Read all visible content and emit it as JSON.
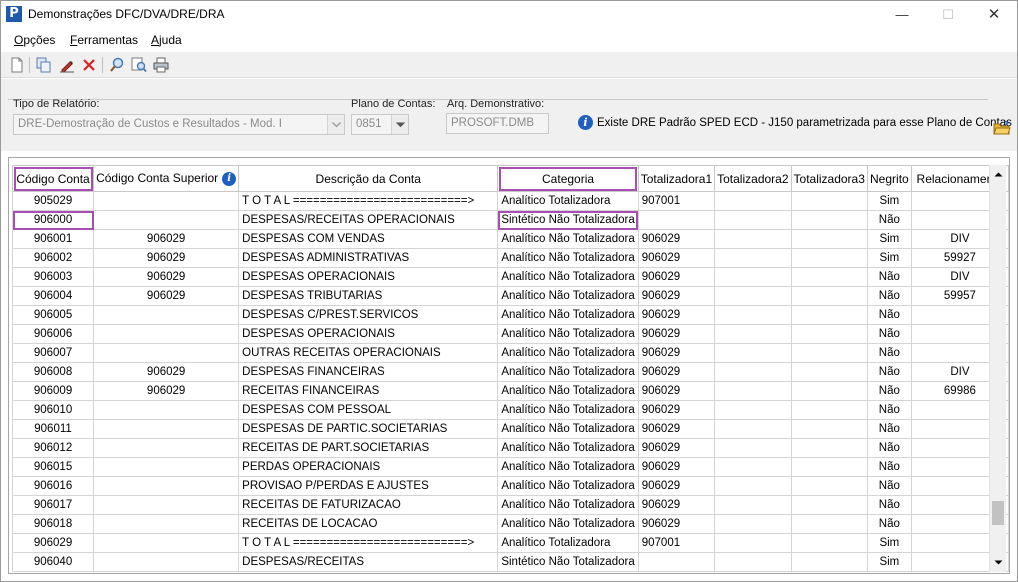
{
  "window": {
    "title": "Demonstrações DFC/DVA/DRE/DRA",
    "app_icon_letter": "P",
    "minimize": "—",
    "maximize": "☐",
    "close": "✕"
  },
  "menu": {
    "items": [
      {
        "key": "O",
        "rest": "pções"
      },
      {
        "key": "F",
        "rest": "erramentas"
      },
      {
        "key": "A",
        "rest": "juda"
      }
    ]
  },
  "toolbar": {
    "icons": [
      "new-document-icon",
      "copy-icon",
      "edit-icon",
      "delete-icon",
      "search-icon",
      "zoom-icon",
      "print-icon"
    ]
  },
  "params": {
    "tipo_relatorio_label": "Tipo de Relatório:",
    "tipo_relatorio_value": "DRE-Demostração de Custos e Resultados - Mod. I",
    "plano_contas_label": "Plano de Contas:",
    "plano_contas_value": "0851",
    "arq_demonstrativo_label": "Arq. Demonstrativo:",
    "arq_demonstrativo_value": "PROSOFT.DMB",
    "info_message": "Existe DRE Padrão SPED ECD - J150 parametrizada para esse Plano de Contas"
  },
  "grid": {
    "columns": [
      "Código Conta",
      "Código Conta Superior",
      "Descrição da Conta",
      "Categoria",
      "Totalizadora1",
      "Totalizadora2",
      "Totalizadora3",
      "Negrito",
      "Relacionamento"
    ],
    "rows": [
      [
        "905029",
        "",
        "T O T A L ==========================>",
        "Analítico Totalizadora",
        "907001",
        "",
        "",
        "Sim",
        ""
      ],
      [
        "906000",
        "",
        "DESPESAS/RECEITAS OPERACIONAIS",
        "Sintético Não Totalizadora",
        "",
        "",
        "",
        "Não",
        ""
      ],
      [
        "906001",
        "906029",
        "DESPESAS COM VENDAS",
        "Analítico Não Totalizadora",
        "906029",
        "",
        "",
        "Sim",
        "DIV"
      ],
      [
        "906002",
        "906029",
        "DESPESAS ADMINISTRATIVAS",
        "Analítico Não Totalizadora",
        "906029",
        "",
        "",
        "Sim",
        "59927"
      ],
      [
        "906003",
        "906029",
        "DESPESAS OPERACIONAIS",
        "Analítico Não Totalizadora",
        "906029",
        "",
        "",
        "Não",
        "DIV"
      ],
      [
        "906004",
        "906029",
        "DESPESAS TRIBUTARIAS",
        "Analítico Não Totalizadora",
        "906029",
        "",
        "",
        "Não",
        "59957"
      ],
      [
        "906005",
        "",
        "DESPESAS C/PREST.SERVICOS",
        "Analítico Não Totalizadora",
        "906029",
        "",
        "",
        "Não",
        ""
      ],
      [
        "906006",
        "",
        "DESPESAS OPERACIONAIS",
        "Analítico Não Totalizadora",
        "906029",
        "",
        "",
        "Não",
        ""
      ],
      [
        "906007",
        "",
        "OUTRAS RECEITAS OPERACIONAIS",
        "Analítico Não Totalizadora",
        "906029",
        "",
        "",
        "Não",
        ""
      ],
      [
        "906008",
        "906029",
        "DESPESAS FINANCEIRAS",
        "Analítico Não Totalizadora",
        "906029",
        "",
        "",
        "Não",
        "DIV"
      ],
      [
        "906009",
        "906029",
        "RECEITAS FINANCEIRAS",
        "Analítico Não Totalizadora",
        "906029",
        "",
        "",
        "Não",
        "69986"
      ],
      [
        "906010",
        "",
        "DESPESAS COM PESSOAL",
        "Analítico Não Totalizadora",
        "906029",
        "",
        "",
        "Não",
        ""
      ],
      [
        "906011",
        "",
        "DESPESAS DE PARTIC.SOCIETARIAS",
        "Analítico Não Totalizadora",
        "906029",
        "",
        "",
        "Não",
        ""
      ],
      [
        "906012",
        "",
        "RECEITAS DE PART.SOCIETARIAS",
        "Analítico Não Totalizadora",
        "906029",
        "",
        "",
        "Não",
        ""
      ],
      [
        "906015",
        "",
        "PERDAS OPERACIONAIS",
        "Analítico Não Totalizadora",
        "906029",
        "",
        "",
        "Não",
        ""
      ],
      [
        "906016",
        "",
        "PROVISAO P/PERDAS E AJUSTES",
        "Analítico Não Totalizadora",
        "906029",
        "",
        "",
        "Não",
        ""
      ],
      [
        "906017",
        "",
        "RECEITAS DE FATURIZACAO",
        "Analítico Não Totalizadora",
        "906029",
        "",
        "",
        "Não",
        ""
      ],
      [
        "906018",
        "",
        "RECEITAS DE LOCACAO",
        "Analítico Não Totalizadora",
        "906029",
        "",
        "",
        "Não",
        ""
      ],
      [
        "906029",
        "",
        "T O T A L ==========================>",
        "Analítico Totalizadora",
        "907001",
        "",
        "",
        "Sim",
        ""
      ],
      [
        "906040",
        "",
        "DESPESAS/RECEITAS",
        "Sintético Não Totalizadora",
        "",
        "",
        "",
        "Sim",
        ""
      ]
    ],
    "highlighted_row_index": 1
  },
  "colors": {
    "highlight": "#a64fb0",
    "info_blue": "#1f5fbf",
    "app_icon_blue": "#1e5aa8"
  }
}
